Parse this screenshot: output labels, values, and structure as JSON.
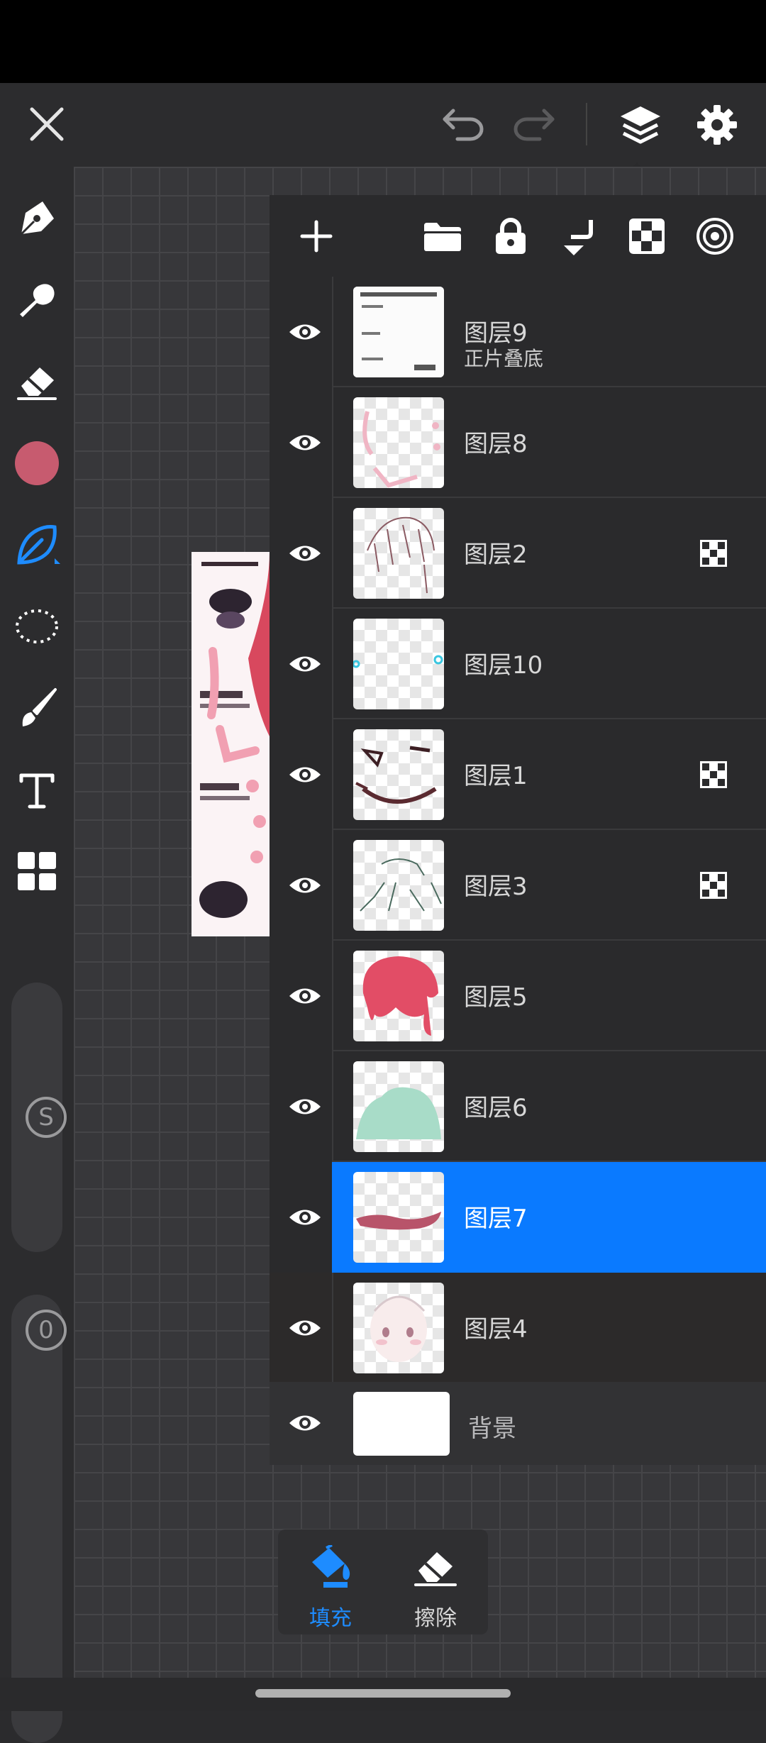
{
  "topbar": {
    "close_icon": "close-icon",
    "undo_icon": "undo-icon",
    "redo_icon": "redo-icon",
    "layers_icon": "layers-icon",
    "settings_icon": "gear-icon"
  },
  "toolbar": {
    "tools": [
      "pen-icon",
      "smudge-icon",
      "eraser-icon",
      "color-swatch",
      "leaf-brush-icon",
      "lasso-icon",
      "brush-icon",
      "text-icon",
      "grid-icon"
    ],
    "active_color": "#c75b6f",
    "size_label": "S",
    "opacity_label": "0"
  },
  "panel": {
    "actions": [
      "add-layer-icon",
      "folder-icon",
      "lock-icon",
      "merge-down-icon",
      "checker-icon",
      "target-icon"
    ],
    "layers": [
      {
        "name": "图层9",
        "sub": "正片叠底",
        "badge": false
      },
      {
        "name": "图层8",
        "sub": "",
        "badge": false
      },
      {
        "name": "图层2",
        "sub": "",
        "badge": true
      },
      {
        "name": "图层10",
        "sub": "",
        "badge": false
      },
      {
        "name": "图层1",
        "sub": "",
        "badge": true
      },
      {
        "name": "图层3",
        "sub": "",
        "badge": true
      },
      {
        "name": "图层5",
        "sub": "",
        "badge": false
      },
      {
        "name": "图层6",
        "sub": "",
        "badge": false
      },
      {
        "name": "图层7",
        "sub": "",
        "badge": false,
        "selected": true
      },
      {
        "name": "图层4",
        "sub": "",
        "badge": false
      }
    ],
    "background_label": "背景",
    "accent_color": "#0a7aff"
  },
  "popup": {
    "fill_label": "填充",
    "erase_label": "擦除"
  }
}
